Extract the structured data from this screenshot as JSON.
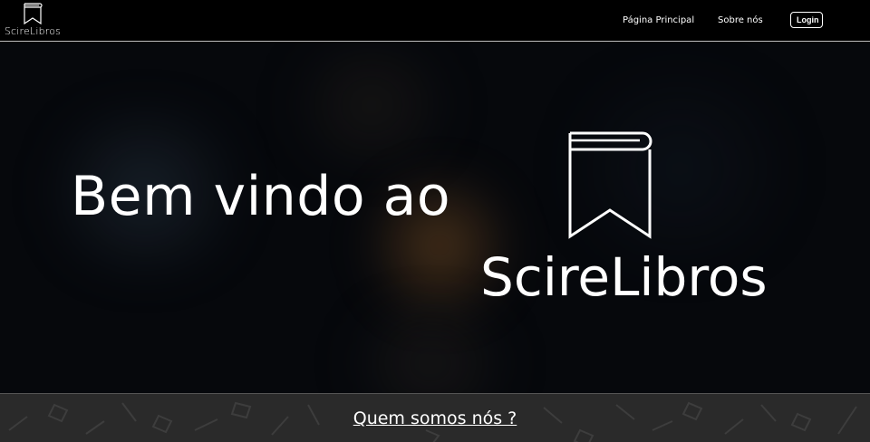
{
  "navbar": {
    "brand": "ScireLibros",
    "links": [
      "Página Principal",
      "Sobre nós"
    ],
    "login_label": "Login"
  },
  "hero": {
    "heading": "Bem vindo ao",
    "brand": "ScireLibros"
  },
  "footer": {
    "link_label": "Quem somos nós ?"
  },
  "icons": {
    "logo": "bookmark-book-icon"
  },
  "colors": {
    "background": "#000000",
    "text": "#ffffff",
    "footer_bg": "#2a2a2a"
  }
}
